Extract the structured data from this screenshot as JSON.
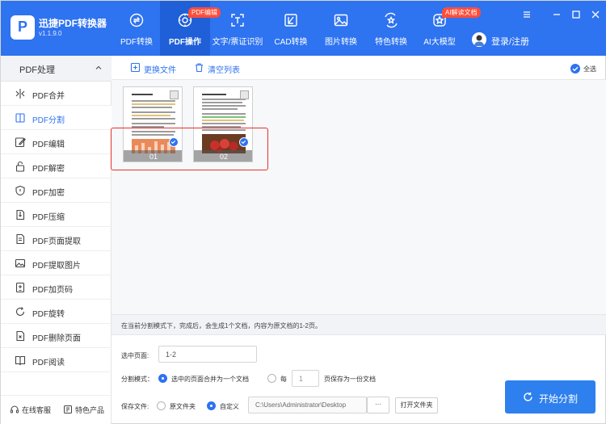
{
  "app": {
    "name": "迅捷PDF转换器",
    "version": "v1.1.9.0",
    "logo_letter": "P"
  },
  "nav": {
    "items": [
      {
        "label": "PDF转换",
        "icon": "chat-swap-icon",
        "badge": ""
      },
      {
        "label": "PDF操作",
        "icon": "gear-document-icon",
        "badge": "PDF编辑"
      },
      {
        "label": "文字/票证识别",
        "icon": "scan-frame-icon",
        "badge": ""
      },
      {
        "label": "CAD转换",
        "icon": "cad-document-icon",
        "badge": ""
      },
      {
        "label": "图片转换",
        "icon": "image-icon",
        "badge": ""
      },
      {
        "label": "特色转换",
        "icon": "star-swap-icon",
        "badge": ""
      },
      {
        "label": "AI大模型",
        "icon": "ai-star-icon",
        "badge": "AI解读文档"
      }
    ],
    "active_index": 1,
    "login_label": "登录/注册"
  },
  "sidebar": {
    "header": "PDF处理",
    "items": [
      {
        "label": "PDF合并",
        "icon": "merge-icon"
      },
      {
        "label": "PDF分割",
        "icon": "split-icon"
      },
      {
        "label": "PDF编辑",
        "icon": "edit-icon"
      },
      {
        "label": "PDF解密",
        "icon": "unlock-icon"
      },
      {
        "label": "PDF加密",
        "icon": "shield-icon"
      },
      {
        "label": "PDF压缩",
        "icon": "compress-icon"
      },
      {
        "label": "PDF页面提取",
        "icon": "page-extract-icon"
      },
      {
        "label": "PDF提取图片",
        "icon": "image-extract-icon"
      },
      {
        "label": "PDF加页码",
        "icon": "page-number-icon"
      },
      {
        "label": "PDF旋转",
        "icon": "rotate-icon"
      },
      {
        "label": "PDF删除页面",
        "icon": "delete-page-icon"
      },
      {
        "label": "PDF阅读",
        "icon": "book-icon"
      }
    ],
    "active_index": 1,
    "footer": {
      "service": "在线客服",
      "products": "特色产品"
    }
  },
  "toolbar": {
    "replace_file": "更换文件",
    "clear_list": "清空列表",
    "select_all": "全选",
    "select_all_checked": true
  },
  "pages": [
    {
      "number": "01",
      "selected": true
    },
    {
      "number": "02",
      "selected": true
    }
  ],
  "info_text": "在当前分割模式下，完成后，会生成1个文档，内容为原文档的1-2页。",
  "form": {
    "selected_pages_label": "选中页面:",
    "selected_pages_value": "1-2",
    "split_mode_label": "分割模式：",
    "mode_merge_label": "选中的页面合并为一个文档",
    "mode_every_label": "每",
    "every_value": "1",
    "every_suffix": "页保存为一份文档",
    "mode_selected": "merge",
    "save_label": "保存文件:",
    "save_original": "原文件夹",
    "save_custom": "自定义",
    "save_selected": "custom",
    "path_value": "C:\\Users\\Administrator\\Desktop",
    "browse_label": "···",
    "open_folder": "打开文件夹"
  },
  "start_button": "开始分割",
  "colors": {
    "brand": "#2e73f0",
    "badge": "#ff4d3a",
    "highlight": "#e5322d"
  }
}
